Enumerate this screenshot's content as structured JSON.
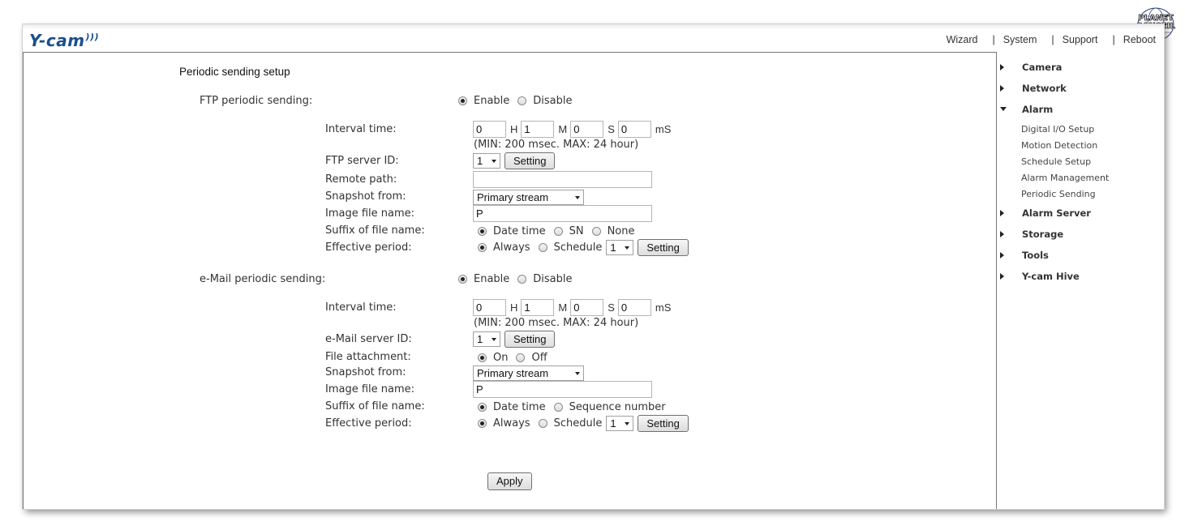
{
  "header": {
    "logo": "Y-cam",
    "nav": [
      "Wizard",
      "System",
      "Support",
      "Reboot"
    ]
  },
  "page": {
    "title": "Periodic sending setup",
    "apply_label": "Apply"
  },
  "ftp": {
    "label": "FTP periodic sending:",
    "enable_label": "Enable",
    "disable_label": "Disable",
    "enabled": true,
    "interval_label": "Interval time:",
    "interval": {
      "h": "0",
      "m": "1",
      "s": "0",
      "ms": "0"
    },
    "units": {
      "h": "H",
      "m": "M",
      "s": "S",
      "ms": "mS"
    },
    "interval_hint": "(MIN: 200 msec. MAX: 24 hour)",
    "server_id_label": "FTP server ID:",
    "server_id": "1",
    "setting_label": "Setting",
    "remote_path_label": "Remote path:",
    "remote_path": "",
    "snapshot_label": "Snapshot from:",
    "snapshot": "Primary stream",
    "image_name_label": "Image file name:",
    "image_name": "P",
    "suffix_label": "Suffix of file name:",
    "suffix_options": [
      "Date time",
      "SN",
      "None"
    ],
    "suffix_selected": 0,
    "period_label": "Effective period:",
    "period_options": [
      "Always",
      "Schedule"
    ],
    "period_selected": 0,
    "schedule_id": "1"
  },
  "email": {
    "label": "e-Mail periodic sending:",
    "enable_label": "Enable",
    "disable_label": "Disable",
    "enabled": true,
    "interval_label": "Interval time:",
    "interval": {
      "h": "0",
      "m": "1",
      "s": "0",
      "ms": "0"
    },
    "units": {
      "h": "H",
      "m": "M",
      "s": "S",
      "ms": "mS"
    },
    "interval_hint": "(MIN: 200 msec. MAX: 24 hour)",
    "server_id_label": "e-Mail server ID:",
    "server_id": "1",
    "setting_label": "Setting",
    "attach_label": "File attachment:",
    "attach_options": [
      "On",
      "Off"
    ],
    "attach_selected": 0,
    "snapshot_label": "Snapshot from:",
    "snapshot": "Primary stream",
    "image_name_label": "Image file name:",
    "image_name": "P",
    "suffix_label": "Suffix of file name:",
    "suffix_options": [
      "Date time",
      "Sequence number"
    ],
    "suffix_selected": 0,
    "period_label": "Effective period:",
    "period_options": [
      "Always",
      "Schedule"
    ],
    "period_selected": 0,
    "schedule_id": "1"
  },
  "sidebar": {
    "items": [
      "Camera",
      "Network",
      "Alarm",
      "Alarm Server",
      "Storage",
      "Tools",
      "Y-cam Hive"
    ],
    "expanded": "Alarm",
    "alarm_sub": [
      "Digital I/O Setup",
      "Motion Detection",
      "Schedule Setup",
      "Alarm Management",
      "Periodic Sending"
    ]
  },
  "watermark": {
    "line1": "PLANET",
    "line2": "SANSEIL"
  }
}
